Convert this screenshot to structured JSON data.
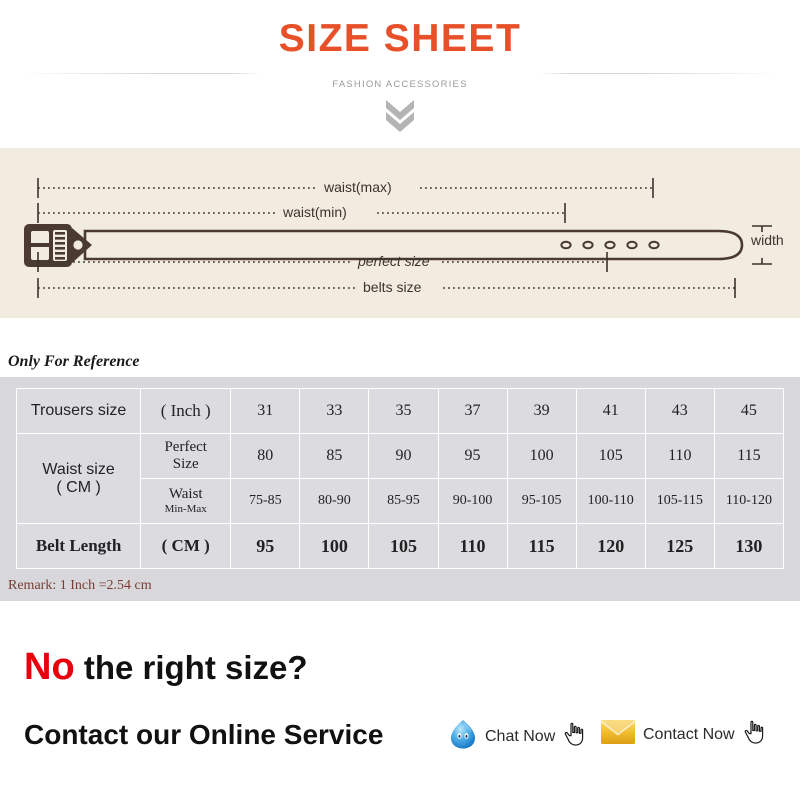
{
  "header": {
    "title": "SIZE SHEET",
    "subtitle": "FASHION ACCESSORIES",
    "title_color": "#e8502a",
    "chevron_icon": "double-chevron-down-icon"
  },
  "belt_diagram": {
    "background_color": "#f2ece0",
    "belt_color": "#4a3a30",
    "hole_count": 5,
    "labels": {
      "waist_max": "waist(max)",
      "waist_min": "waist(min)",
      "perfect_size": "perfect size",
      "belts_size": "belts size",
      "width": "width"
    }
  },
  "reference_note": "Only For Reference",
  "table": {
    "background_color": "#d8d8dc",
    "cell_color": "#dcdce0",
    "rows": [
      {
        "label": "Trousers size",
        "unit": "( Inch )",
        "values": [
          "31",
          "33",
          "35",
          "37",
          "39",
          "41",
          "43",
          "45"
        ]
      },
      {
        "label": "Waist size",
        "label_unit": "( CM )",
        "sub_label": "Perfect",
        "sub_label2": "Size",
        "values": [
          "80",
          "85",
          "90",
          "95",
          "100",
          "105",
          "110",
          "115"
        ]
      },
      {
        "sub_label": "Waist",
        "sub_label2": "Min-Max",
        "values": [
          "75-85",
          "80-90",
          "85-95",
          "90-100",
          "95-105",
          "100-110",
          "105-115",
          "110-120"
        ]
      },
      {
        "label": "Belt Length",
        "unit": "( CM )",
        "values": [
          "95",
          "100",
          "105",
          "110",
          "115",
          "120",
          "125",
          "130"
        ]
      }
    ]
  },
  "remark": "Remark: 1 Inch =2.54 cm",
  "cta": {
    "line1_emphasis": "No",
    "line1_rest": " the right size?",
    "line2": "Contact our Online Service",
    "chat": {
      "label": "Chat Now",
      "icon": "chat-droplet-icon",
      "cursor_icon": "pointing-hand-icon",
      "color": "#3ea3e0"
    },
    "mail": {
      "label": "Contact Now",
      "icon": "envelope-icon",
      "cursor_icon": "pointing-hand-icon",
      "color": "#efb827"
    },
    "emphasis_color": "#e8000d"
  }
}
